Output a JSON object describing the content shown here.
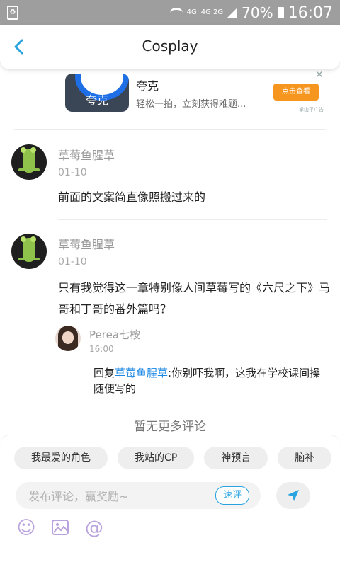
{
  "status_bar": {
    "network_top": "4G",
    "network_bottom": "4G 2G",
    "battery_percent": "70%",
    "time": "16:07"
  },
  "header": {
    "title": "Cosplay"
  },
  "ad": {
    "icon_label": "夸克",
    "app_name": "夸克",
    "description": "轻松一拍，立刻获得难题...",
    "cta": "点击查看",
    "source": "掌山平广告"
  },
  "comments": [
    {
      "username": "草莓鱼腥草",
      "date": "01-10",
      "text": "前面的文案简直像照搬过来的"
    },
    {
      "username": "草莓鱼腥草",
      "date": "01-10",
      "text": "只有我觉得这一章特别像人间草莓写的《六尺之下》马哥和丁哥的番外篇吗？"
    }
  ],
  "reply": {
    "username": "Perea七桉",
    "time": "16:00",
    "prefix": "回复",
    "mention": "草莓鱼腥草",
    "text": ":你别吓我啊，这我在学校课间操随便写的"
  },
  "no_more": "暂无更多评论",
  "chips": [
    "我最爱的角色",
    "我站的CP",
    "神预言",
    "脑补"
  ],
  "input": {
    "placeholder": "发布评论，赢奖励~"
  },
  "quick_review": "速评",
  "colors": {
    "link": "#1e88e5",
    "accent_blue": "#29a3e0",
    "cta": "#f7961e",
    "tool_icons": "#b9a3de"
  },
  "icons": [
    "back-arrow-icon",
    "close-icon",
    "send-icon",
    "emoji-icon",
    "image-icon",
    "mention-icon"
  ]
}
